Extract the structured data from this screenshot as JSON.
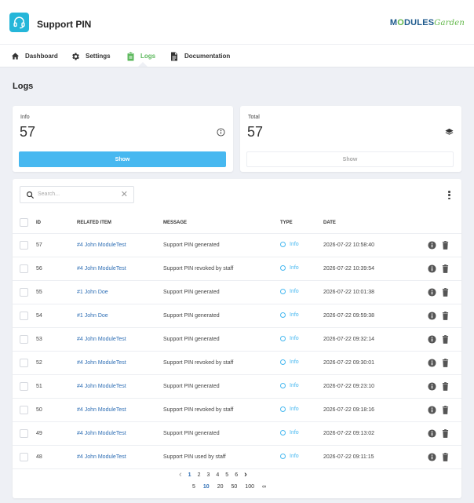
{
  "app": {
    "title": "Support PIN",
    "brand_main": "M",
    "brand_accent": "O",
    "brand_rest": "DULES",
    "brand_script": "Garden"
  },
  "nav": [
    {
      "label": "Dashboard",
      "icon": "home-icon"
    },
    {
      "label": "Settings",
      "icon": "gear-icon"
    },
    {
      "label": "Logs",
      "icon": "clipboard-icon",
      "active": true
    },
    {
      "label": "Documentation",
      "icon": "document-icon"
    }
  ],
  "page": {
    "title": "Logs"
  },
  "stats": {
    "info": {
      "label": "Info",
      "value": "57",
      "button": "Show"
    },
    "total": {
      "label": "Total",
      "value": "57",
      "button": "Show"
    }
  },
  "search": {
    "placeholder": "Search...",
    "clear": "✕"
  },
  "table": {
    "headers": {
      "id": "ID",
      "related": "RELATED ITEM",
      "message": "MESSAGE",
      "type": "TYPE",
      "date": "DATE"
    },
    "rows": [
      {
        "id": "57",
        "related": "#4 John ModuleTest",
        "message": "Support PIN generated",
        "type": "Info",
        "date": "2026-07-22 10:58:40"
      },
      {
        "id": "56",
        "related": "#4 John ModuleTest",
        "message": "Support PIN revoked by staff",
        "type": "Info",
        "date": "2026-07-22 10:39:54"
      },
      {
        "id": "55",
        "related": "#1 John Doe",
        "message": "Support PIN generated",
        "type": "Info",
        "date": "2026-07-22 10:01:38"
      },
      {
        "id": "54",
        "related": "#1 John Doe",
        "message": "Support PIN generated",
        "type": "Info",
        "date": "2026-07-22 09:59:38"
      },
      {
        "id": "53",
        "related": "#4 John ModuleTest",
        "message": "Support PIN generated",
        "type": "Info",
        "date": "2026-07-22 09:32:14"
      },
      {
        "id": "52",
        "related": "#4 John ModuleTest",
        "message": "Support PIN revoked by staff",
        "type": "Info",
        "date": "2026-07-22 09:30:01"
      },
      {
        "id": "51",
        "related": "#4 John ModuleTest",
        "message": "Support PIN generated",
        "type": "Info",
        "date": "2026-07-22 09:23:10"
      },
      {
        "id": "50",
        "related": "#4 John ModuleTest",
        "message": "Support PIN revoked by staff",
        "type": "Info",
        "date": "2026-07-22 09:18:16"
      },
      {
        "id": "49",
        "related": "#4 John ModuleTest",
        "message": "Support PIN generated",
        "type": "Info",
        "date": "2026-07-22 09:13:02"
      },
      {
        "id": "48",
        "related": "#4 John ModuleTest",
        "message": "Support PIN used by staff",
        "type": "Info",
        "date": "2026-07-22 09:11:15"
      }
    ]
  },
  "pagination": {
    "prev": "‹",
    "next": "›",
    "pages": [
      "1",
      "2",
      "3",
      "4",
      "5",
      "6"
    ],
    "active_page": "1",
    "sizes": [
      "5",
      "10",
      "20",
      "50",
      "100",
      "∞"
    ],
    "active_size": "10"
  },
  "colors": {
    "accent": "#47b8f0",
    "link": "#2f6fb5",
    "active_nav": "#5cb85c",
    "logo_bg": "#25b6d9"
  }
}
